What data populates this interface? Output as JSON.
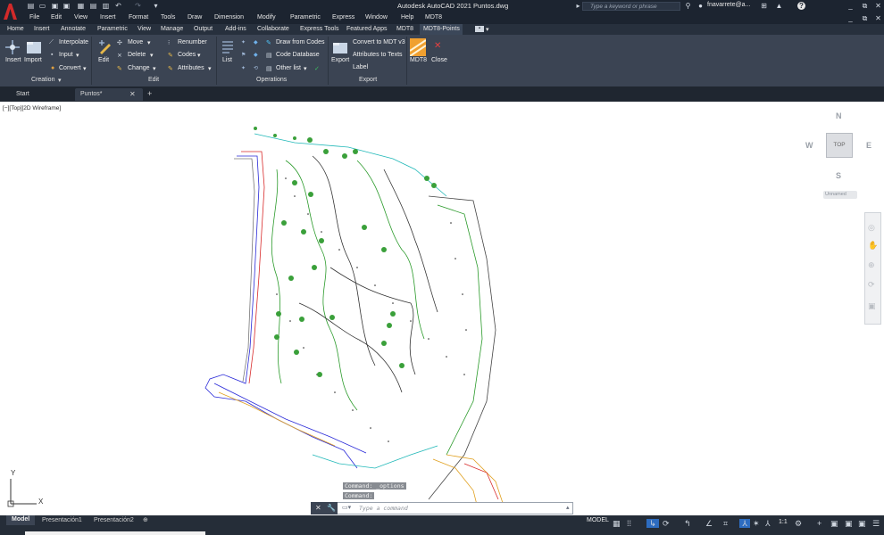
{
  "titlebar": {
    "title": "Autodesk AutoCAD 2021   Puntos.dwg",
    "search_placeholder": "Type a keyword or phrase",
    "user": "fnavarrete@a...",
    "help": "?"
  },
  "menu": [
    "File",
    "Edit",
    "View",
    "Insert",
    "Format",
    "Tools",
    "Draw",
    "Dimension",
    "Modify",
    "Parametric",
    "Express",
    "Window",
    "Help",
    "MDT8"
  ],
  "ribbon_tabs": [
    "Home",
    "Insert",
    "Annotate",
    "Parametric",
    "View",
    "Manage",
    "Output",
    "Add-ins",
    "Collaborate",
    "Express Tools",
    "Featured Apps",
    "MDT8",
    "MDT8-Points"
  ],
  "ribbon": {
    "creation": {
      "insert": "Insert",
      "import": "Import",
      "interpolate": "Interpolate",
      "input": "Input",
      "convert": "Convert",
      "panel": "Creation"
    },
    "edit": {
      "edit": "Edit",
      "move": "Move",
      "delete": "Delete",
      "change": "Change",
      "panel": "Edit"
    },
    "codes": {
      "renumber": "Renumber",
      "codes": "Codes",
      "attributes": "Attributes"
    },
    "operations": {
      "list": "List",
      "draw_from_codes": "Draw from Codes",
      "code_database": "Code Database",
      "other_list": "Other list",
      "panel": "Operations"
    },
    "export": {
      "export": "Export",
      "convert_mdt": "Convert to MDT v3",
      "attributes_to_texts": "Attributes to Texts",
      "label": "Label",
      "panel": "Export"
    },
    "mdt": {
      "mdt8": "MDT8",
      "close": "Close"
    }
  },
  "doc_tabs": [
    "Start",
    "Puntos*"
  ],
  "view_label": "[−][Top][2D Wireframe]",
  "viewcube": {
    "n": "N",
    "s": "S",
    "e": "E",
    "w": "W",
    "top": "TOP",
    "ucs": "Unnamed"
  },
  "ucs_axis": {
    "x": "X",
    "y": "Y"
  },
  "command": {
    "history1": "Command: _options",
    "history2": "Command:",
    "placeholder": "Type a command"
  },
  "layout_tabs": [
    "Model",
    "Presentación1",
    "Presentación2"
  ],
  "status": {
    "model": "MODEL",
    "scale": "1:1"
  }
}
